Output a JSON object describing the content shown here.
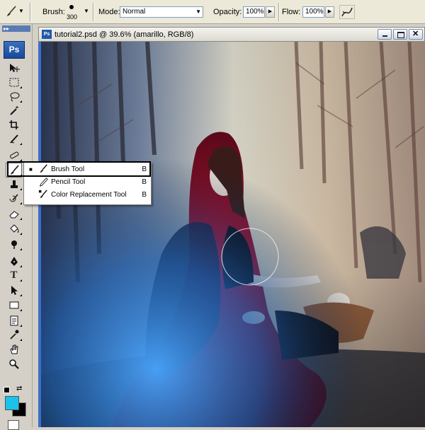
{
  "options_bar": {
    "brush_label": "Brush:",
    "brush_size": "300",
    "mode_label": "Mode:",
    "mode_value": "Normal",
    "opacity_label": "Opacity:",
    "opacity_value": "100%",
    "flow_label": "Flow:",
    "flow_value": "100%"
  },
  "toolbox": {
    "logo": "Ps",
    "grip": "▸▸",
    "tools": [
      "move",
      "marquee",
      "lasso",
      "magic-wand",
      "crop",
      "slice",
      "healing",
      "brush",
      "clone-stamp",
      "history-brush",
      "eraser",
      "paint-bucket",
      "dodge",
      "pen",
      "type",
      "path-select",
      "shape",
      "notes",
      "eyedropper",
      "hand",
      "zoom"
    ],
    "foreground_color": "#19c3ec",
    "background_color": "#000000"
  },
  "document": {
    "title": "tutorial2.psd @ 39.6% (amarillo, RGB/8)",
    "icon_text": "Ps"
  },
  "flyout": {
    "items": [
      {
        "name": "Brush Tool",
        "shortcut": "B",
        "selected": true
      },
      {
        "name": "Pencil Tool",
        "shortcut": "B",
        "selected": false
      },
      {
        "name": "Color Replacement Tool",
        "shortcut": "B",
        "selected": false
      }
    ]
  }
}
